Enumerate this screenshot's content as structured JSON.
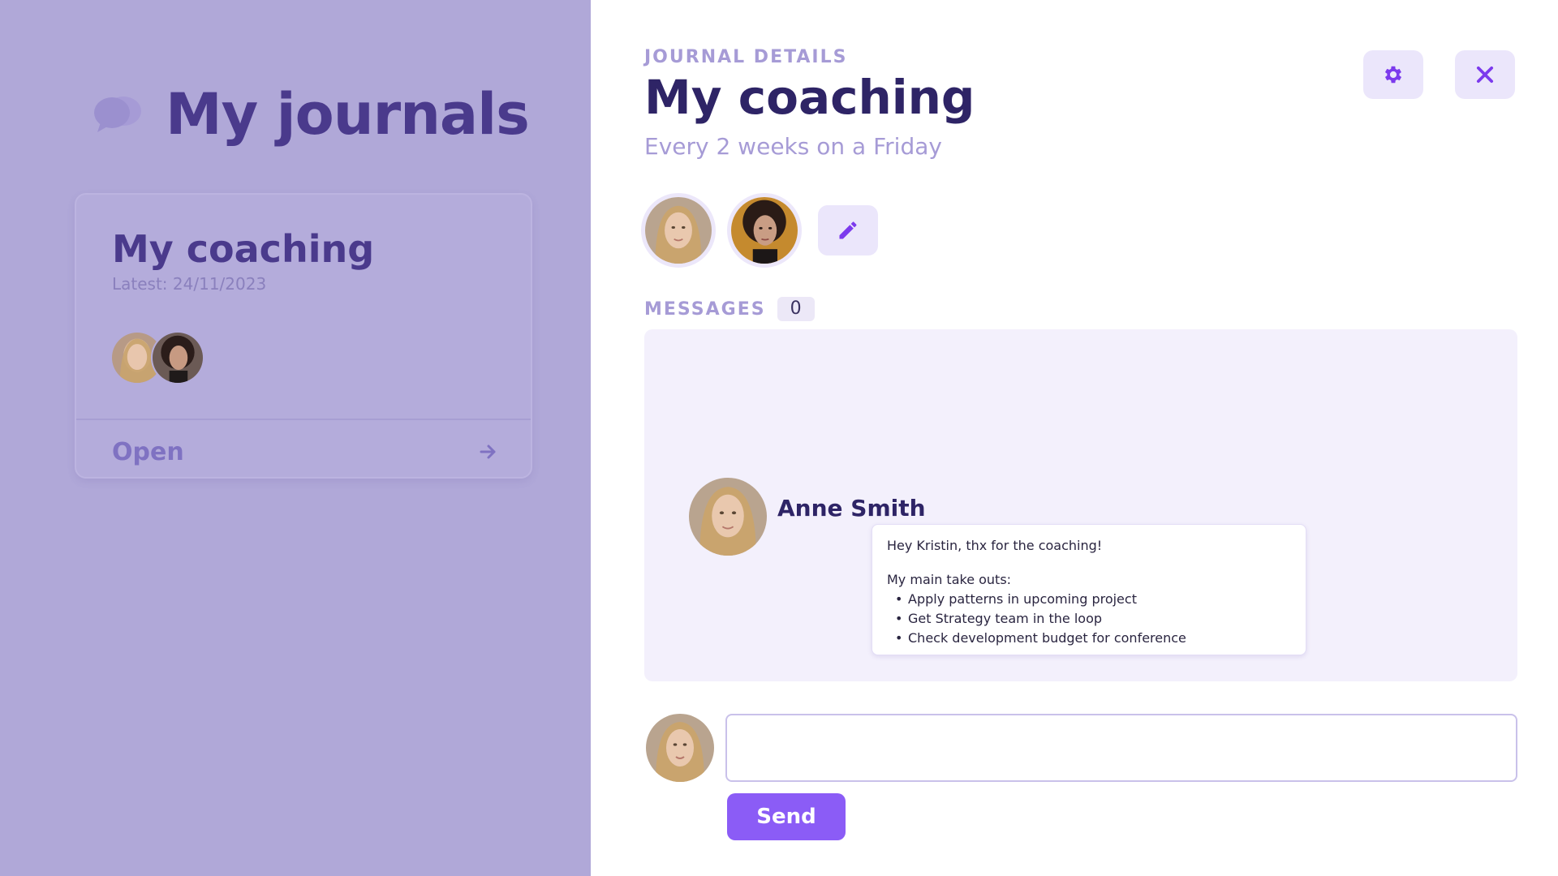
{
  "sidebar": {
    "heading": "My journals",
    "icon": "chat-bubbles-icon",
    "journal_card": {
      "title": "My coaching",
      "latest": "Latest: 24/11/2023",
      "open_label": "Open",
      "open_icon": "arrow-right-icon"
    }
  },
  "detail": {
    "eyebrow": "JOURNAL DETAILS",
    "title": "My coaching",
    "schedule": "Every 2 weeks on a Friday",
    "settings_icon": "gear-icon",
    "close_icon": "close-icon",
    "edit_icon": "pencil-icon",
    "messages_label": "MESSAGES",
    "messages_count": "0",
    "messages": [
      {
        "author": "Anne Smith",
        "greeting": "Hey Kristin, thx for the coaching!",
        "intro": "My main take outs:",
        "bullets": [
          "Apply patterns in upcoming project",
          "Get Strategy team in the loop",
          "Check development budget for conference"
        ]
      }
    ],
    "composer": {
      "value": "",
      "placeholder": "",
      "send_label": "Send"
    }
  },
  "colors": {
    "sidebar_bg": "#b0a8d8",
    "accent": "#8b5cf6",
    "title": "#2e2466",
    "muted": "#a69bd6",
    "message_area_bg": "#f3f0fc"
  }
}
